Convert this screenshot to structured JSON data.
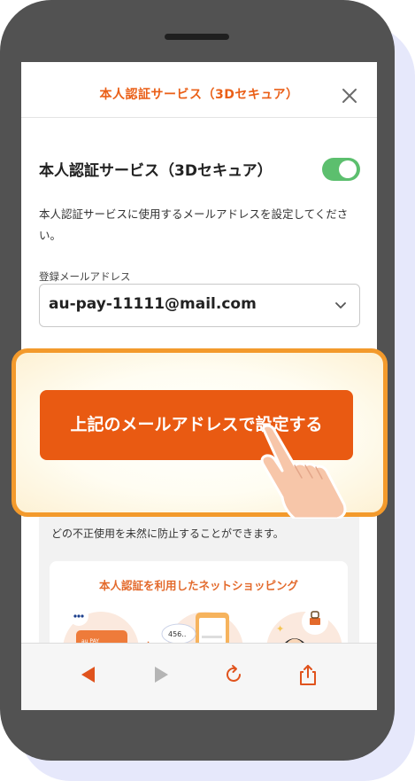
{
  "modal": {
    "title": "本人認証サービス（3Dセキュア）"
  },
  "settings": {
    "section_title": "本人認証サービス（3Dセキュア）",
    "toggle_on": true,
    "description": "本人認証サービスに使用するメールアドレスを設定してください。",
    "email_label": "登録メールアドレス",
    "email_value": "au-pay-11111@mail.com"
  },
  "cta": {
    "label": "上記のメールアドレスで設定する"
  },
  "info": {
    "text": "どの不正使用を未然に防止することができます。",
    "card_title": "本人認証を利用したネットショッピング",
    "card_brand": "au PAY",
    "code_text": "456.."
  },
  "toolbar": {
    "back": "back-icon",
    "forward": "forward-icon",
    "reload": "reload-icon",
    "share": "share-icon"
  },
  "colors": {
    "accent": "#e95a12",
    "toggle": "#5cbf6e",
    "highlight": "#f39a2c",
    "phone_frame": "#525252"
  }
}
